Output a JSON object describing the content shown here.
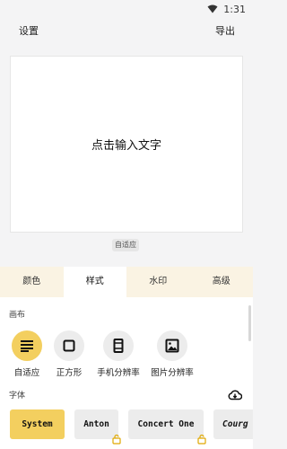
{
  "status_bar": {
    "time": "1:31"
  },
  "top_bar": {
    "settings_label": "设置",
    "export_label": "导出"
  },
  "canvas": {
    "placeholder": "点击输入文字",
    "ratio_badge": "自适应"
  },
  "tabs": [
    {
      "label": "颜色",
      "active": false
    },
    {
      "label": "样式",
      "active": true
    },
    {
      "label": "水印",
      "active": false
    },
    {
      "label": "高级",
      "active": false
    }
  ],
  "canvas_section": {
    "title": "画布",
    "options": [
      {
        "label": "自适应",
        "icon": "align-lines-icon",
        "active": true
      },
      {
        "label": "正方形",
        "icon": "square-icon",
        "active": false
      },
      {
        "label": "手机分辨率",
        "icon": "phone-frame-icon",
        "active": false
      },
      {
        "label": "图片分辨率",
        "icon": "image-icon",
        "active": false
      }
    ]
  },
  "font_section": {
    "title": "字体",
    "fonts": [
      {
        "label": "System",
        "active": true,
        "locked": false
      },
      {
        "label": "Anton",
        "active": false,
        "locked": true
      },
      {
        "label": "Concert One",
        "active": false,
        "locked": true
      },
      {
        "label": "Courg",
        "active": false,
        "locked": false
      }
    ]
  },
  "colors": {
    "accent": "#f3cf5f",
    "tab_bar_bg": "#faf3e3",
    "chip_bg": "#ececec"
  }
}
